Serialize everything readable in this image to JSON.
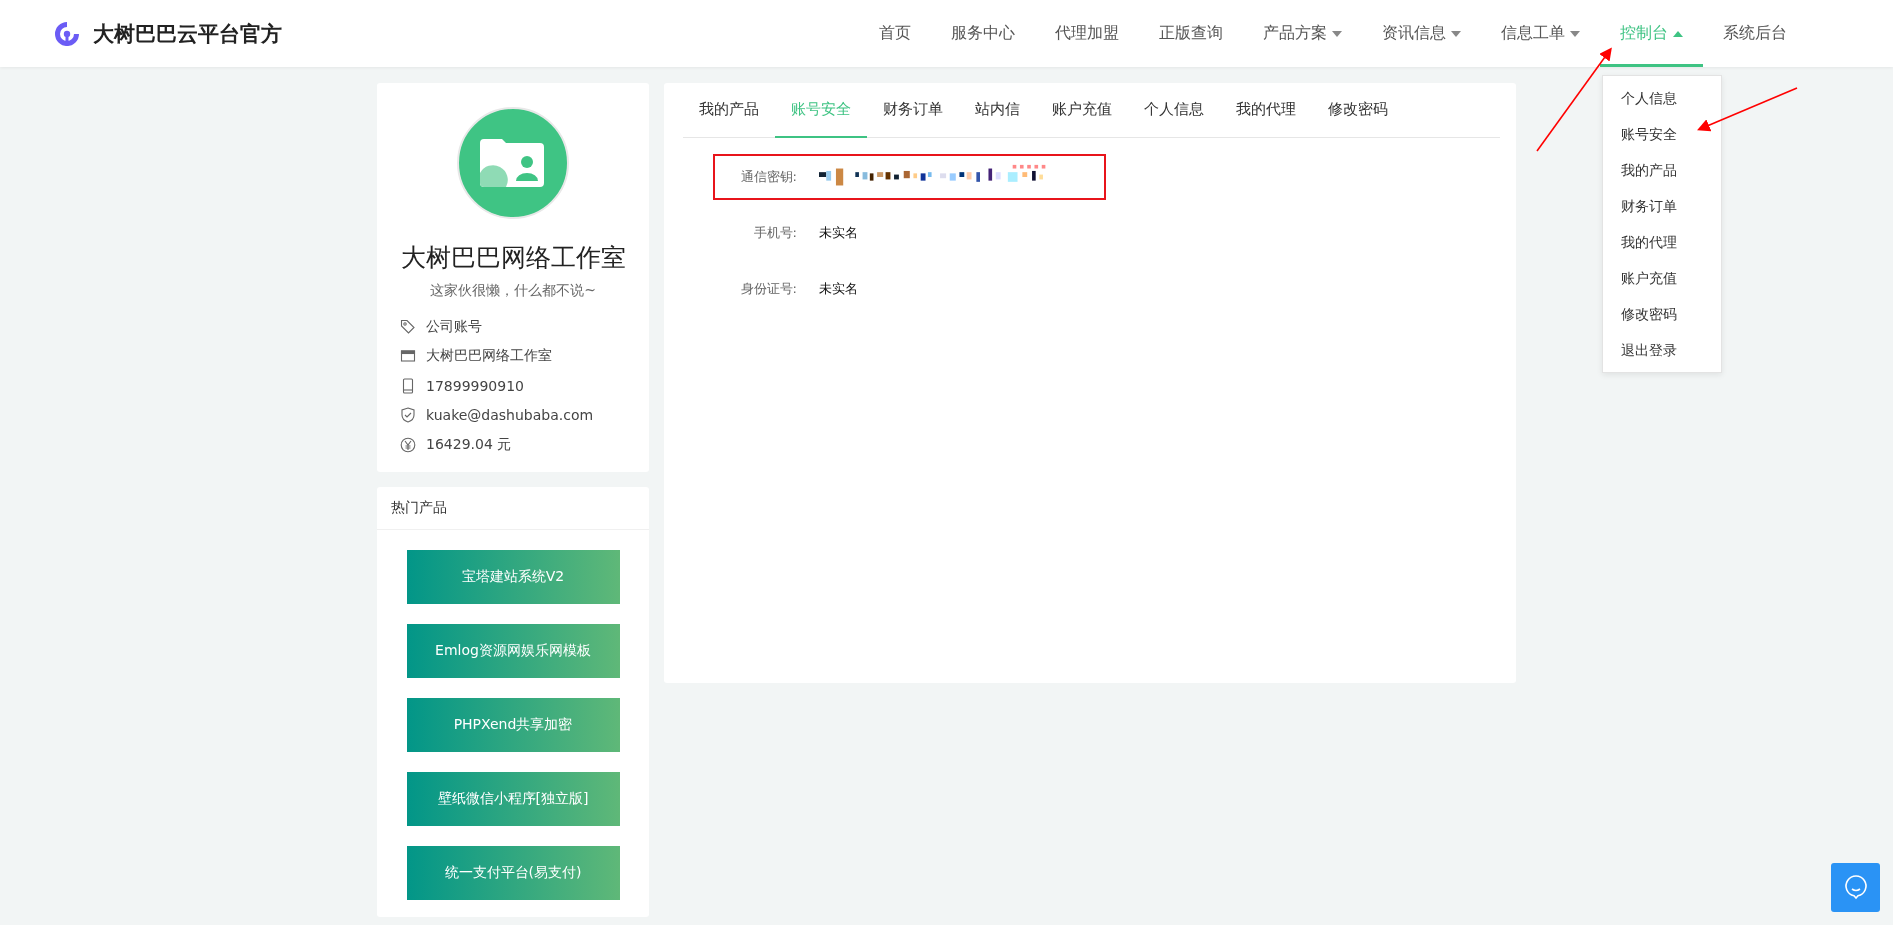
{
  "brand": {
    "name": "大树巴巴云平台官方"
  },
  "nav": [
    {
      "label": "首页",
      "dropdown": false,
      "selected": false
    },
    {
      "label": "服务中心",
      "dropdown": false,
      "selected": false
    },
    {
      "label": "代理加盟",
      "dropdown": false,
      "selected": false
    },
    {
      "label": "正版查询",
      "dropdown": false,
      "selected": false
    },
    {
      "label": "产品方案",
      "dropdown": true,
      "selected": false,
      "expanded": false
    },
    {
      "label": "资讯信息",
      "dropdown": true,
      "selected": false,
      "expanded": false
    },
    {
      "label": "信息工单",
      "dropdown": true,
      "selected": false,
      "expanded": false
    },
    {
      "label": "控制台",
      "dropdown": true,
      "selected": true,
      "expanded": true
    },
    {
      "label": "系统后台",
      "dropdown": false,
      "selected": false
    }
  ],
  "dropdown_menu": [
    "个人信息",
    "账号安全",
    "我的产品",
    "财务订单",
    "我的代理",
    "账户充值",
    "修改密码",
    "退出登录"
  ],
  "profile": {
    "name": "大树巴巴网络工作室",
    "bio": "这家伙很懒，什么都不说~",
    "details": [
      {
        "kind": "tag",
        "text": "公司账号"
      },
      {
        "kind": "card",
        "text": "大树巴巴网络工作室"
      },
      {
        "kind": "phone",
        "text": "17899990910"
      },
      {
        "kind": "shield",
        "text": "kuake@dashubaba.com"
      },
      {
        "kind": "yen",
        "text": "16429.04 元"
      }
    ]
  },
  "hot_products": {
    "title": "热门产品",
    "items": [
      "宝塔建站系统V2",
      "Emlog资源网娱乐网模板",
      "PHPXend共享加密",
      "壁纸微信小程序[独立版]",
      "统一支付平台(易支付)"
    ]
  },
  "tabs": [
    {
      "label": "我的产品",
      "selected": false
    },
    {
      "label": "账号安全",
      "selected": true
    },
    {
      "label": "财务订单",
      "selected": false
    },
    {
      "label": "站内信",
      "selected": false
    },
    {
      "label": "账户充值",
      "selected": false
    },
    {
      "label": "个人信息",
      "selected": false
    },
    {
      "label": "我的代理",
      "selected": false
    },
    {
      "label": "修改密码",
      "selected": false
    }
  ],
  "fields": [
    {
      "label": "通信密钥:",
      "kind": "masked",
      "highlighted": true
    },
    {
      "label": "手机号:",
      "kind": "text",
      "value": "未实名",
      "highlighted": false
    },
    {
      "label": "身份证号:",
      "kind": "text",
      "value": "未实名",
      "highlighted": false
    }
  ]
}
